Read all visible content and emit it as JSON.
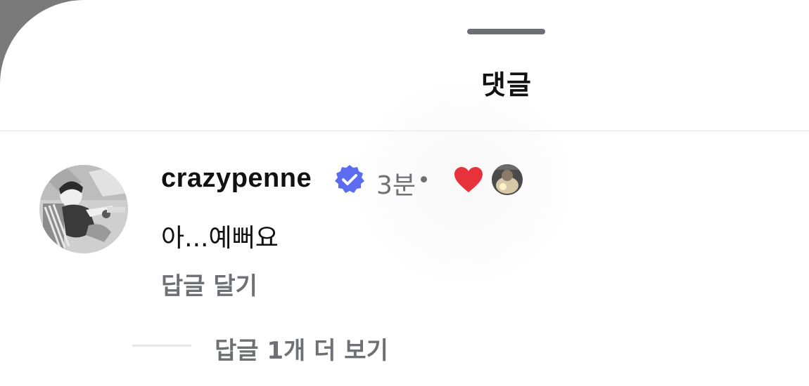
{
  "sheet": {
    "title": "댓글"
  },
  "comment": {
    "username": "crazypenne",
    "verified_icon": "verified-badge-icon",
    "time": "3분",
    "text": "아...예뻐요",
    "reply_label": "답글 달기",
    "liked_by_creator": true,
    "heart_icon": "heart-icon"
  },
  "replies": {
    "more_label": "답글 1개 더 보기"
  },
  "colors": {
    "verified": "#5b6cf0",
    "heart": "#e8323b",
    "muted_text": "#6e7075",
    "primary_text": "#111111",
    "divider": "#e3e5e8",
    "overlay": "#7a7a7a"
  }
}
